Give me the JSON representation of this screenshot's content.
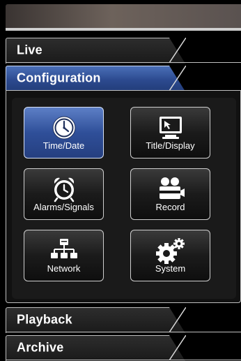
{
  "sections": {
    "live": {
      "label": "Live"
    },
    "configuration": {
      "label": "Configuration"
    },
    "playback": {
      "label": "Playback"
    },
    "archive": {
      "label": "Archive"
    }
  },
  "configuration_items": [
    {
      "label": "Time/Date",
      "icon": "clock-icon",
      "selected": true
    },
    {
      "label": "Title/Display",
      "icon": "monitor-icon",
      "selected": false
    },
    {
      "label": "Alarms/Signals",
      "icon": "alarm-clock-icon",
      "selected": false
    },
    {
      "label": "Record",
      "icon": "video-camera-icon",
      "selected": false
    },
    {
      "label": "Network",
      "icon": "network-icon",
      "selected": false
    },
    {
      "label": "System",
      "icon": "gears-icon",
      "selected": false
    }
  ],
  "colors": {
    "accent_blue": "#2c4a8f",
    "tab_dark": "#1a1a1a",
    "border": "#bfbfbf"
  }
}
